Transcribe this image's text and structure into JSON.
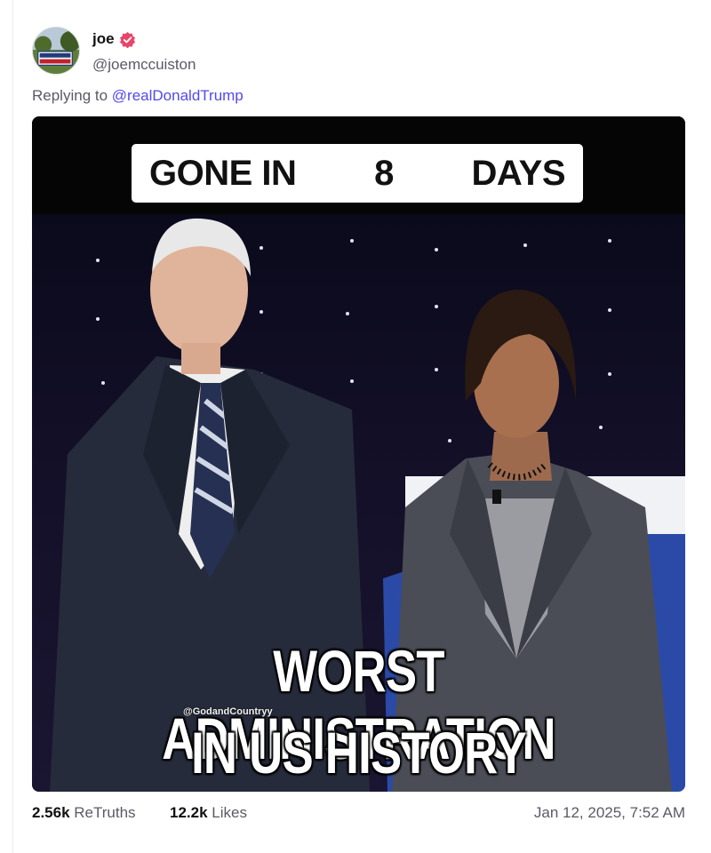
{
  "post": {
    "author": {
      "display_name": "joe",
      "handle": "@joemccuiston",
      "verified": true,
      "avatar_sign_text": "TRUMP COUNTRY"
    },
    "reply": {
      "prefix": "Replying to",
      "target": "@realDonaldTrump"
    },
    "image": {
      "banner": {
        "word1": "GONE IN",
        "number": "8",
        "word2": "DAYS"
      },
      "caption_line1": "WORST ADMINISTRATION",
      "caption_line2": "IN US HISTORY",
      "watermark": "@GodandCountryy"
    },
    "stats": {
      "retruths_count": "2.56k",
      "retruths_label": "ReTruths",
      "likes_count": "12.2k",
      "likes_label": "Likes"
    },
    "timestamp": "Jan 12, 2025, 7:52 AM"
  },
  "colors": {
    "link": "#5448ee",
    "verified_badge": "#e9456b",
    "muted_text": "#5a5a66"
  },
  "icons": [
    "verified-badge-icon"
  ]
}
